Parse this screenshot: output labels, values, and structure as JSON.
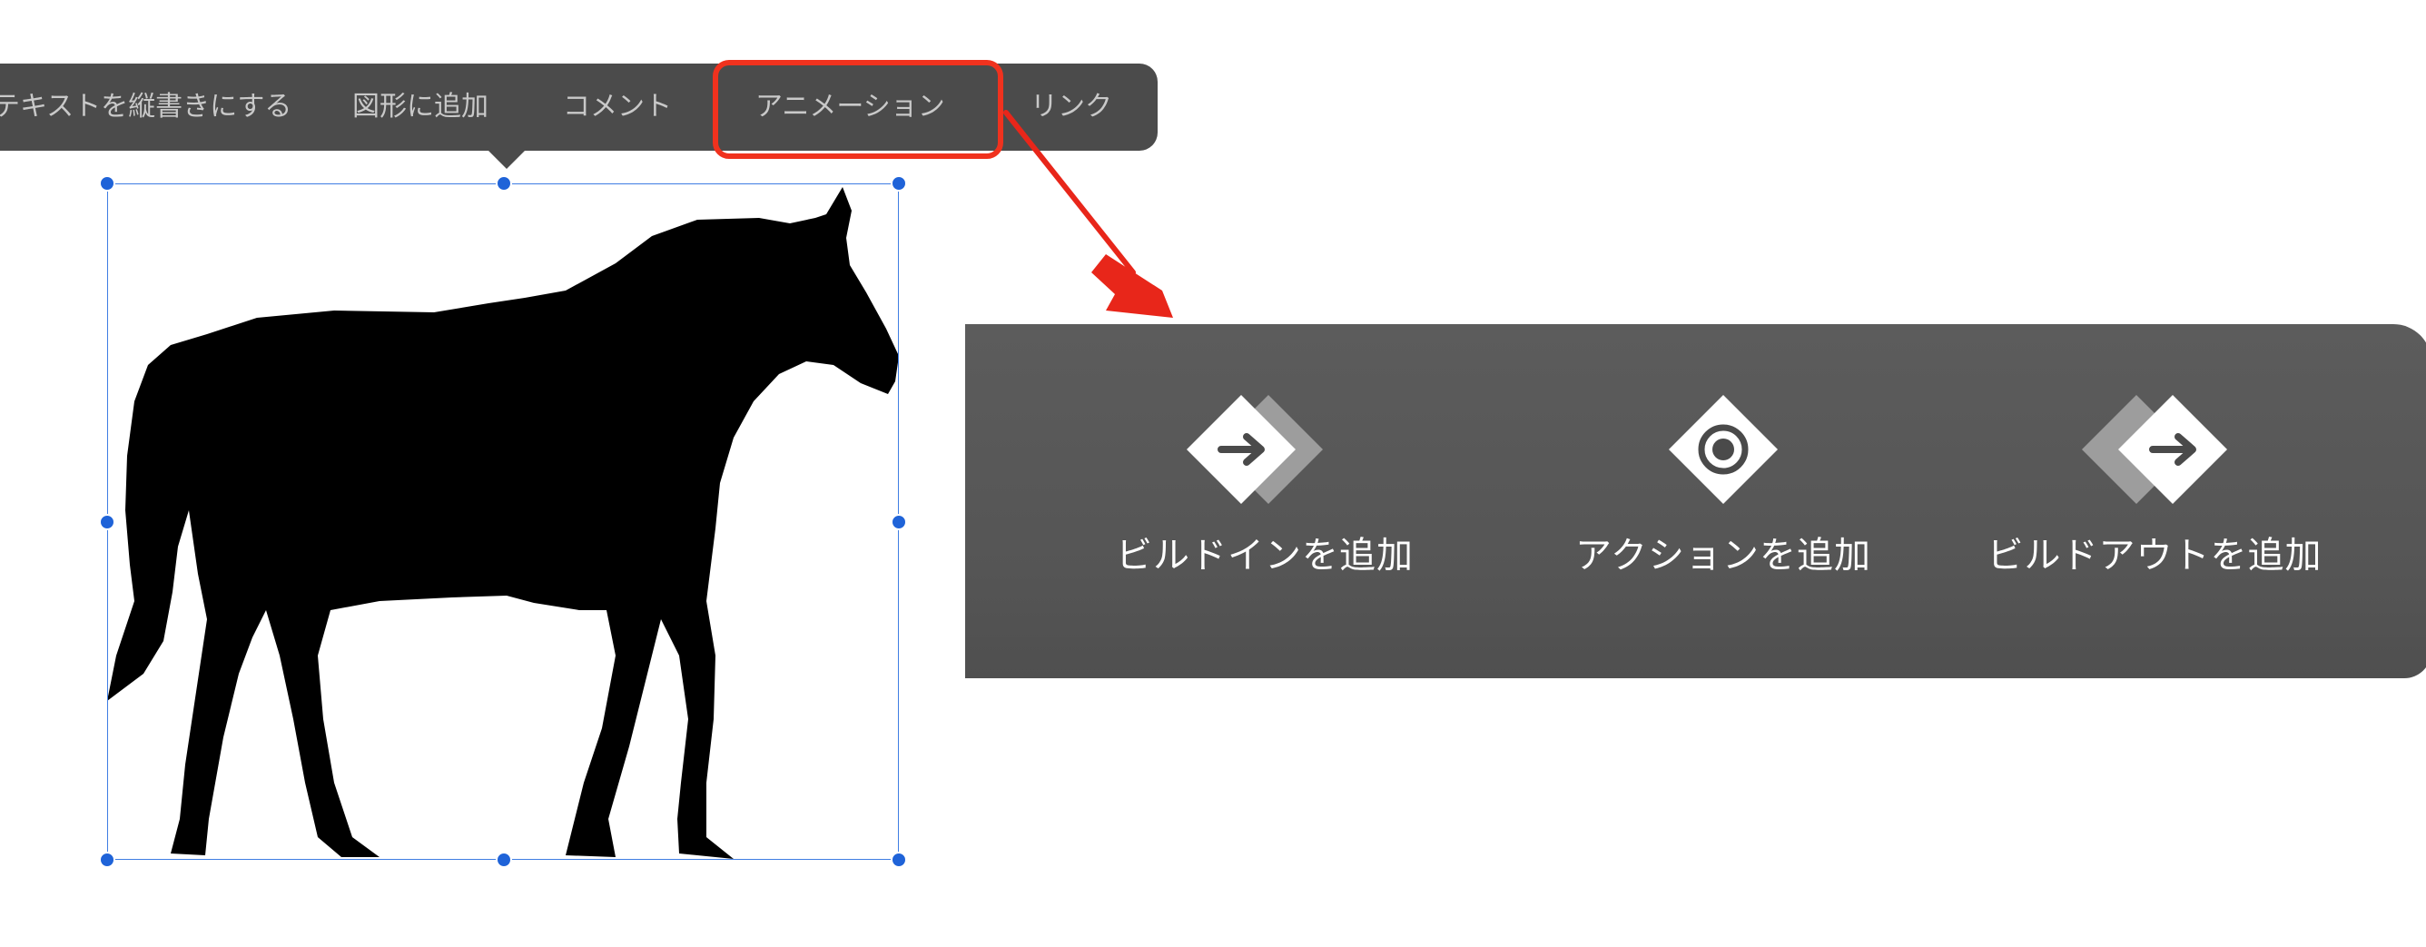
{
  "toolbar": {
    "items": [
      {
        "label": "テキストを縦書きにする"
      },
      {
        "label": "図形に追加"
      },
      {
        "label": "コメント"
      },
      {
        "label": "アニメーション"
      },
      {
        "label": "リンク"
      }
    ]
  },
  "animation_panel": {
    "items": [
      {
        "label": "ビルドインを追加",
        "icon": "build-in-icon"
      },
      {
        "label": "アクションを追加",
        "icon": "action-icon"
      },
      {
        "label": "ビルドアウトを追加",
        "icon": "build-out-icon"
      }
    ]
  },
  "colors": {
    "toolbar_bg": "#4b4b4b",
    "panel_bg": "#5a5a5a",
    "highlight": "#f0321e",
    "selection": "#1f63d8"
  }
}
